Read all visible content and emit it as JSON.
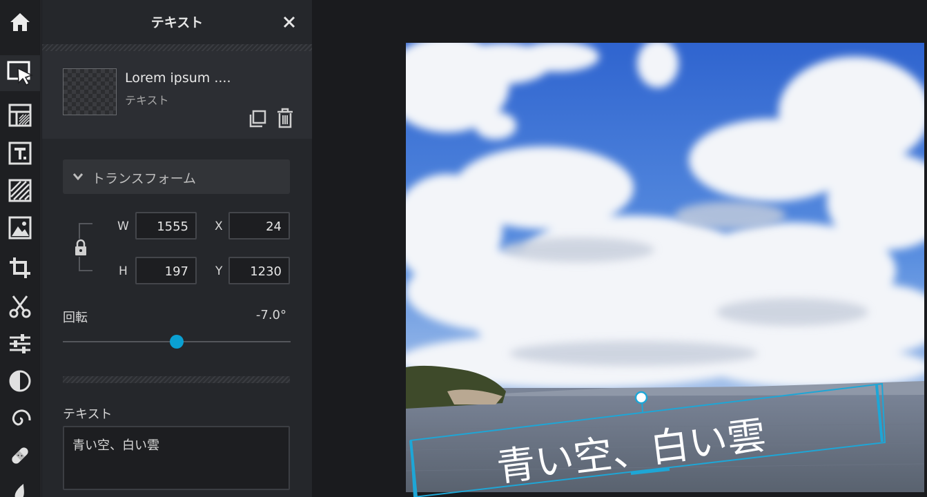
{
  "panel": {
    "title": "テキスト"
  },
  "layer": {
    "name": "Lorem ipsum ....",
    "type": "テキスト"
  },
  "transform": {
    "label": "トランスフォーム",
    "w_label": "W",
    "w_value": "1555",
    "x_label": "X",
    "x_value": "24",
    "h_label": "H",
    "h_value": "197",
    "y_label": "Y",
    "y_value": "1230"
  },
  "rotation": {
    "label": "回転",
    "value": "-7.0°",
    "slider_fraction": 0.5
  },
  "text_section": {
    "label": "テキスト",
    "value": "青い空、白い雲"
  },
  "canvas": {
    "overlay_text": "青い空、白い雲",
    "selection_color": "#1ea6d6"
  },
  "tools": [
    {
      "icon": "home-icon"
    },
    {
      "icon": "select-arrow-icon"
    },
    {
      "icon": "layout-template-icon"
    },
    {
      "icon": "text-tool-icon"
    },
    {
      "icon": "texture-icon"
    },
    {
      "icon": "image-icon"
    },
    {
      "icon": "crop-icon"
    },
    {
      "icon": "scissors-icon"
    },
    {
      "icon": "sliders-icon"
    },
    {
      "icon": "contrast-icon"
    },
    {
      "icon": "spiral-icon"
    },
    {
      "icon": "bandage-icon"
    },
    {
      "icon": "drop-icon"
    }
  ],
  "colors": {
    "accent": "#0aa0d2",
    "panel_bg": "#25272b",
    "rail_bg": "#1e1f22"
  }
}
